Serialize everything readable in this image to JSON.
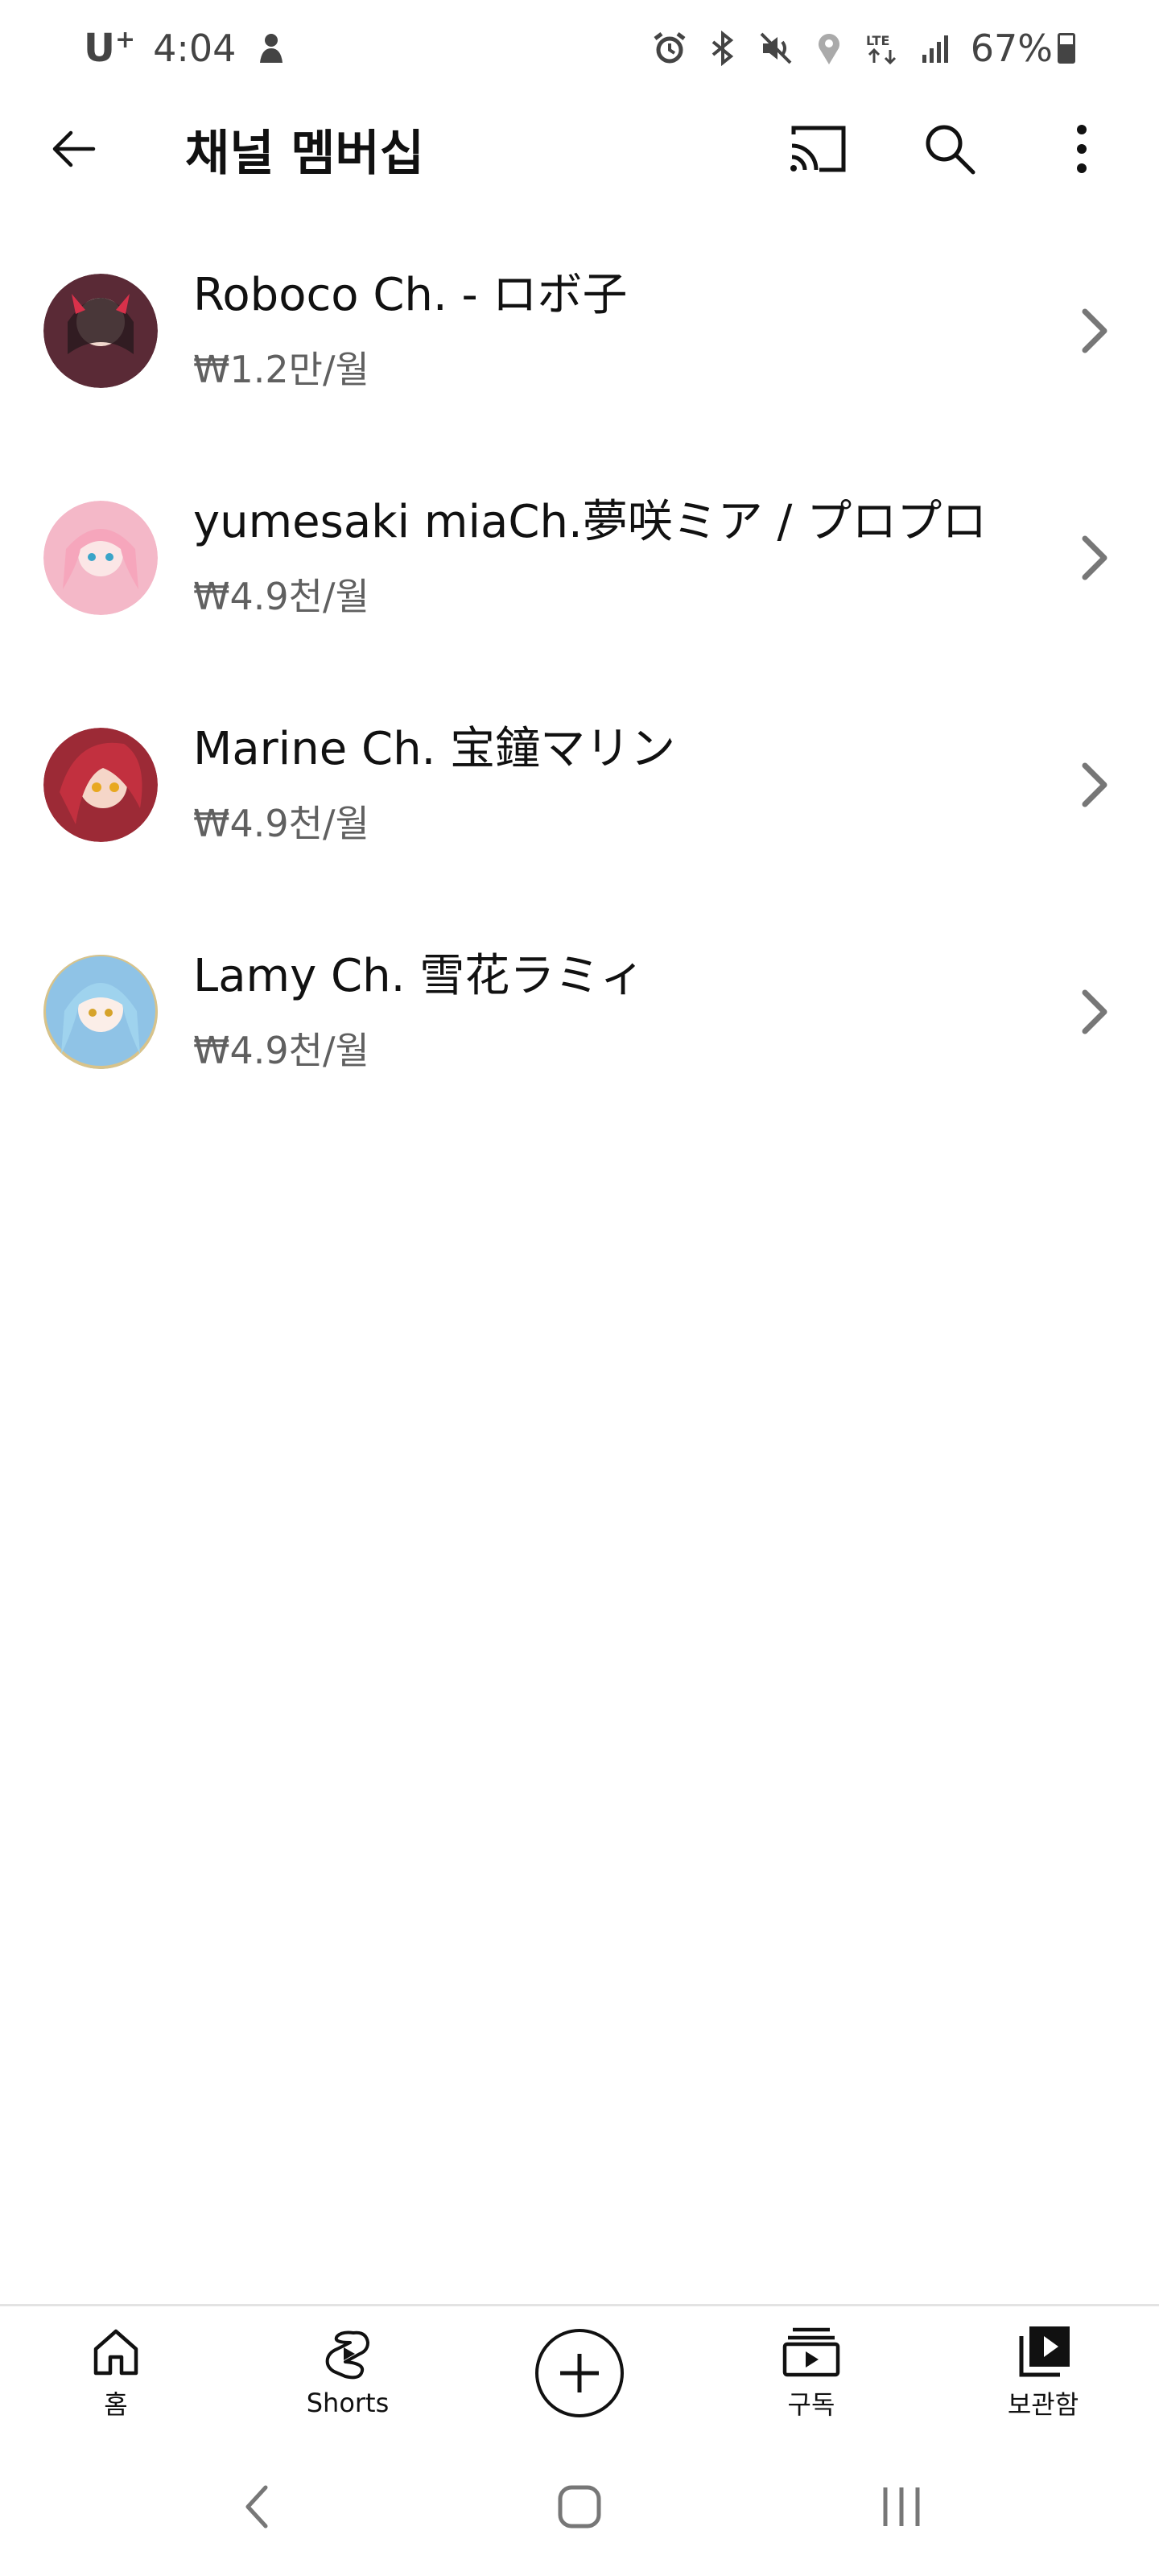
{
  "status_bar": {
    "carrier": "U",
    "carrier_plus": "+",
    "time": "4:04",
    "battery_text": "67%",
    "battery_level": 0.67,
    "icons": [
      "person-icon",
      "alarm-icon",
      "bluetooth-icon",
      "mute-icon",
      "location-icon",
      "lte-icon",
      "signal-icon",
      "battery-icon"
    ]
  },
  "app_bar": {
    "title": "채널 멤버십",
    "actions": [
      "cast-icon",
      "search-icon",
      "more-vert-icon"
    ]
  },
  "members": [
    {
      "name": "Roboco Ch. - ロボ子",
      "price": "₩1.2만/월",
      "avatar_color": "#5a2a36"
    },
    {
      "name": "yumesaki miaCh.夢咲ミア / プロプロ",
      "price": "₩4.9천/월",
      "avatar_color": "#f4b8c8"
    },
    {
      "name": "Marine Ch. 宝鐘マリン",
      "price": "₩4.9천/월",
      "avatar_color": "#9c2a36"
    },
    {
      "name": "Lamy Ch. 雪花ラミィ",
      "price": "₩4.9천/월",
      "avatar_color": "#8fc3e6"
    }
  ],
  "bottom_nav": [
    {
      "label": "홈",
      "icon": "home-icon"
    },
    {
      "label": "Shorts",
      "icon": "shorts-icon"
    },
    {
      "label": "",
      "icon": "create-icon"
    },
    {
      "label": "구독",
      "icon": "subscriptions-icon"
    },
    {
      "label": "보관함",
      "icon": "library-icon"
    }
  ],
  "colors": {
    "text_primary": "#111111",
    "text_secondary": "#606060",
    "chevron": "#777777",
    "divider": "#e3e3e3"
  }
}
